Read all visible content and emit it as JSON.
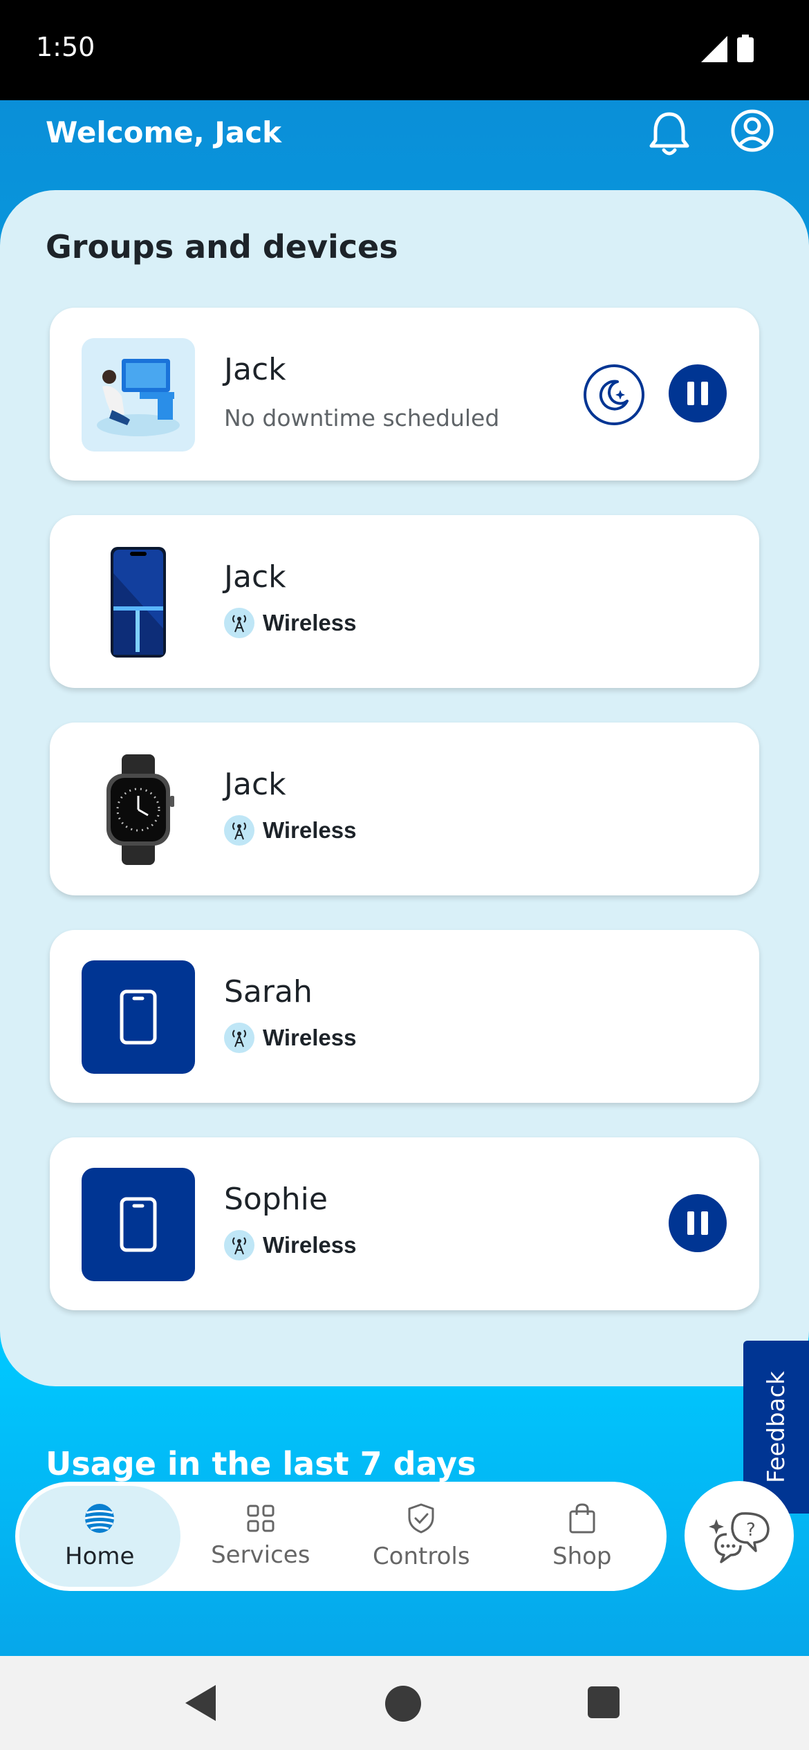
{
  "status_bar": {
    "time": "1:50"
  },
  "header": {
    "welcome": "Welcome, Jack"
  },
  "groups": {
    "title": "Groups and devices",
    "cards": [
      {
        "name": "Jack",
        "subtitle": "No downtime scheduled",
        "image": "person-at-computer-illustration",
        "actions": [
          "moon-schedule",
          "pause"
        ]
      },
      {
        "name": "Jack",
        "type": "Wireless",
        "image": "smartphone-photo"
      },
      {
        "name": "Jack",
        "type": "Wireless",
        "image": "smartwatch-photo"
      },
      {
        "name": "Sarah",
        "type": "Wireless",
        "image": "phone-icon"
      },
      {
        "name": "Sophie",
        "type": "Wireless",
        "image": "phone-icon",
        "actions": [
          "pause"
        ]
      }
    ]
  },
  "usage": {
    "title": "Usage in the last 7 days"
  },
  "feedback": {
    "label": "Feedback"
  },
  "nav": {
    "items": [
      {
        "label": "Home",
        "icon": "att-globe-icon",
        "active": true
      },
      {
        "label": "Services",
        "icon": "grid-icon"
      },
      {
        "label": "Controls",
        "icon": "shield-check-icon"
      },
      {
        "label": "Shop",
        "icon": "shopping-bag-icon"
      }
    ]
  },
  "colors": {
    "primary": "#003593",
    "accent": "#00a8e0",
    "panel": "#d9f0f8"
  }
}
